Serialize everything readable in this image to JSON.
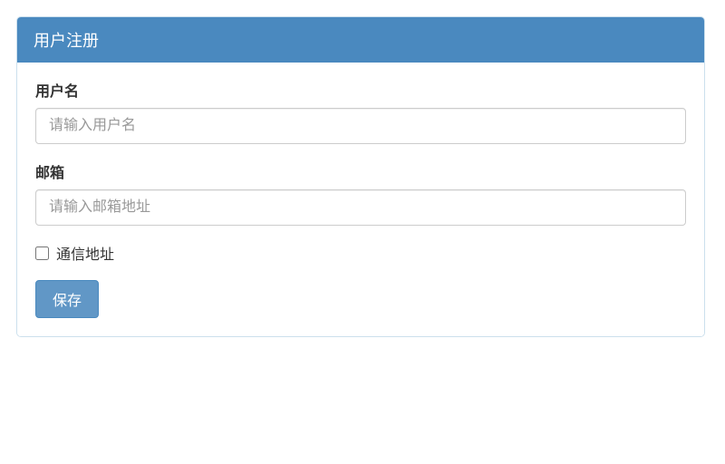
{
  "panel": {
    "title": "用户注册"
  },
  "form": {
    "username": {
      "label": "用户名",
      "placeholder": "请输入用户名",
      "value": ""
    },
    "email": {
      "label": "邮箱",
      "placeholder": "请输入邮箱地址",
      "value": ""
    },
    "address_checkbox": {
      "label": "通信地址",
      "checked": false
    },
    "save_button": "保存"
  }
}
